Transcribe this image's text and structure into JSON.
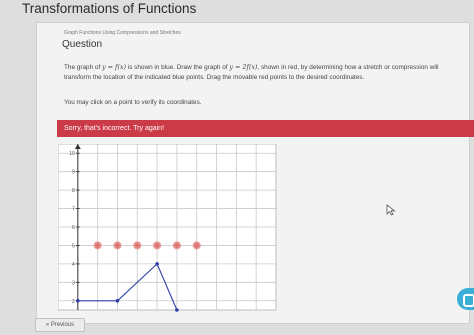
{
  "page": {
    "title": "Transformations of Functions"
  },
  "question": {
    "breadcrumb": "Graph Functions Using Compressions and Stretches",
    "heading": "Question",
    "text_1": "The graph of ",
    "math_1": "y = f(x)",
    "text_2": " is shown in blue. Draw the graph of ",
    "math_2": "y = 2f(x)",
    "text_3": ", shown in red, by determining how a stretch or compression will transform the location of the indicated blue points. Drag the movable red points to the desired coordinates.",
    "hint": "You may click on a point to verify its coordinates."
  },
  "feedback": {
    "message": "Sorry, that's incorrect. Try again!",
    "color": "#cb3a47"
  },
  "graph": {
    "y_tick_labels": [
      "10",
      "9",
      "8",
      "7",
      "6",
      "5",
      "4",
      "3",
      "2"
    ],
    "x_range": [
      -1,
      10
    ],
    "y_range": [
      1.5,
      10.5
    ],
    "blue_color": "#2f3fa8",
    "red_color": "#d9534f",
    "blue_points": [
      [
        0,
        2
      ],
      [
        2,
        2
      ],
      [
        4,
        4
      ],
      [
        5,
        1.5
      ]
    ],
    "red_points": [
      [
        1,
        5
      ],
      [
        2,
        5
      ],
      [
        3,
        5
      ],
      [
        4,
        5
      ],
      [
        5,
        5
      ],
      [
        6,
        5
      ]
    ]
  },
  "nav": {
    "previous_label": "« Previous"
  },
  "icons": {
    "cursor": "cursor-icon",
    "side_tab": "chat-icon"
  }
}
